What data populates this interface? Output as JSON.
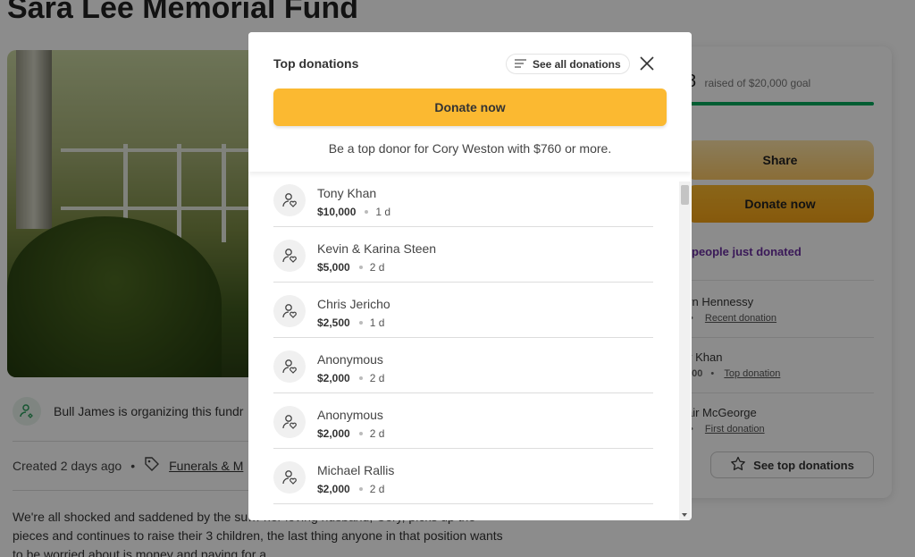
{
  "background": {
    "campaign_title": "Sara Lee Memorial Fund",
    "organizer_text": "Bull James is organizing this fundr",
    "created_text": "Created 2 days ago",
    "category": "Funerals & M",
    "story": "We're all shocked and saddened by the su… her loving husband, Cory, picks up the pieces and continues to raise their 3 children, the last thing anyone in that position wants to be worried about is money and paying for a",
    "raised_amount": "8",
    "raised_text": "raised of $20,000 goal",
    "share_label": "Share",
    "donate_label": "Donate now",
    "just_donated": "people just donated",
    "recent": [
      {
        "name": "vn Hennessy",
        "amount": "",
        "tag": "Recent donation"
      },
      {
        "name": "y Khan",
        "amount": "000",
        "tag": "Top donation"
      },
      {
        "name": "air McGeorge",
        "amount": "",
        "tag": "First donation"
      }
    ],
    "see_top_label": "See top donations"
  },
  "modal": {
    "title": "Top donations",
    "see_all_label": "See all donations",
    "donate_label": "Donate now",
    "top_donor_text": "Be a top donor for Cory Weston with $760 or more.",
    "donations": [
      {
        "name": "Tony Khan",
        "amount": "$10,000",
        "ago": "1 d"
      },
      {
        "name": "Kevin & Karina Steen",
        "amount": "$5,000",
        "ago": "2 d"
      },
      {
        "name": "Chris Jericho",
        "amount": "$2,500",
        "ago": "1 d"
      },
      {
        "name": "Anonymous",
        "amount": "$2,000",
        "ago": "2 d"
      },
      {
        "name": "Anonymous",
        "amount": "$2,000",
        "ago": "2 d"
      },
      {
        "name": "Michael Rallis",
        "amount": "$2,000",
        "ago": "2 d"
      }
    ]
  },
  "icons": {
    "donor_avatar": "donor-heart-icon",
    "sort": "sort-lines-icon",
    "close": "close-icon",
    "tag": "tag-icon",
    "star": "star-icon"
  },
  "colors": {
    "accent_yellow": "#fbb931",
    "progress_green": "#02a95c",
    "purple_text": "#6b2fa0"
  }
}
